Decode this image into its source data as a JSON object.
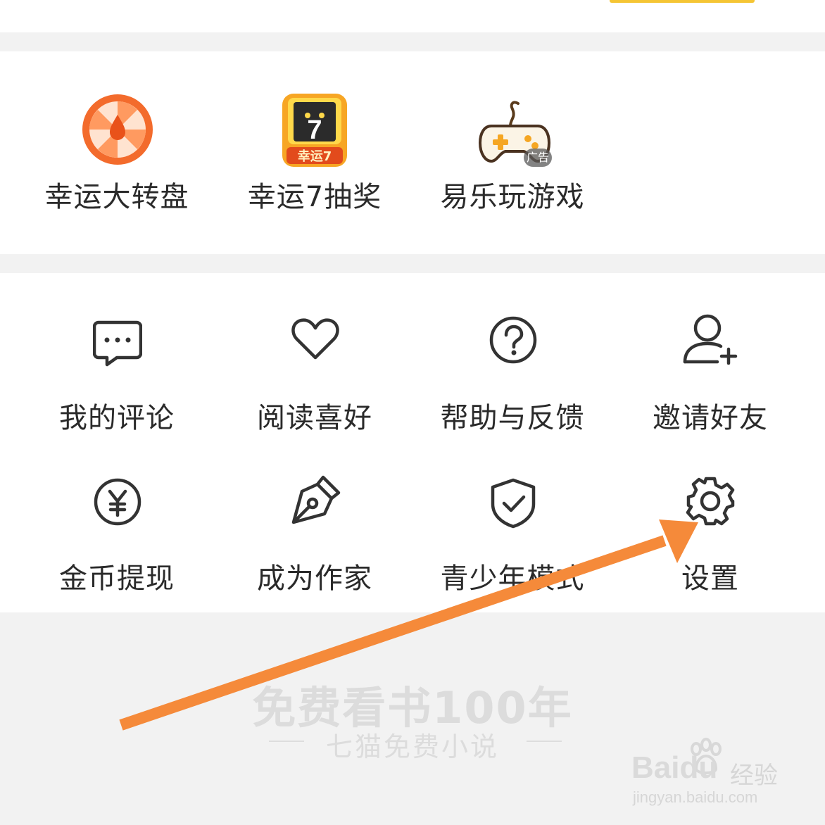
{
  "games": [
    {
      "label": "幸运大转盘",
      "icon": "lucky-wheel-icon"
    },
    {
      "label": "幸运7抽奖",
      "icon": "lucky7-slot-icon",
      "badge": "幸运7",
      "digit": "7"
    },
    {
      "label": "易乐玩游戏",
      "icon": "gamepad-icon",
      "ad_badge": "广告"
    }
  ],
  "tools": [
    {
      "label": "我的评论",
      "icon": "comment-icon"
    },
    {
      "label": "阅读喜好",
      "icon": "heart-icon"
    },
    {
      "label": "帮助与反馈",
      "icon": "help-icon"
    },
    {
      "label": "邀请好友",
      "icon": "invite-user-icon"
    },
    {
      "label": "金币提现",
      "icon": "yen-coin-icon"
    },
    {
      "label": "成为作家",
      "icon": "pen-nib-icon"
    },
    {
      "label": "青少年模式",
      "icon": "shield-check-icon"
    },
    {
      "label": "设置",
      "icon": "gear-icon"
    }
  ],
  "footer": {
    "slogan": "免费看书100年",
    "sub_slogan": "七猫免费小说"
  },
  "watermark": {
    "main": "Baidu",
    "cn": "经验",
    "url": "jingyan.baidu.com"
  },
  "colors": {
    "accent_orange": "#f5822a",
    "annotation_arrow": "#f58a3a",
    "icon_stroke": "#333333"
  }
}
